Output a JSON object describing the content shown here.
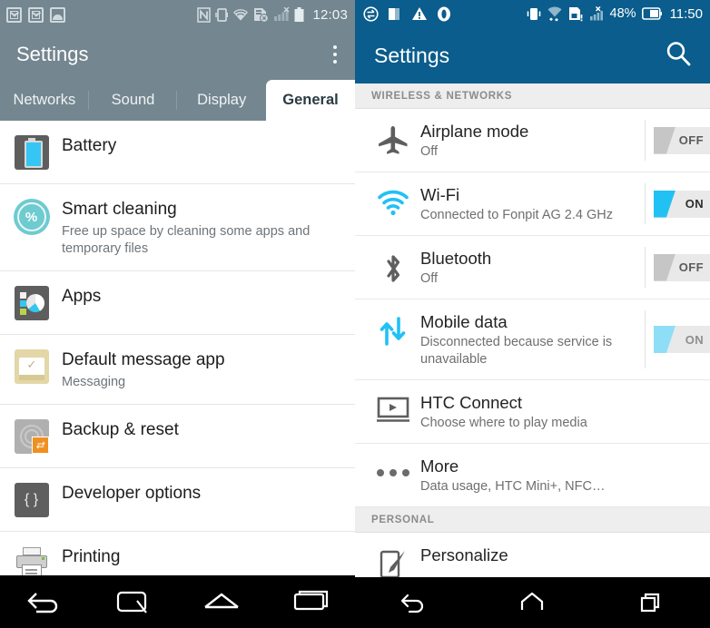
{
  "left_panel": {
    "platform": "lg-settings",
    "status_bar": {
      "left_icons": [
        "email-icon",
        "email-icon",
        "gallery-image-icon"
      ],
      "right_icons": [
        "nfc-icon",
        "vibrate-icon",
        "wifi-icon",
        "sim-error-icon",
        "signal-bars-icon",
        "battery-icon"
      ],
      "clock": "12:03"
    },
    "title": "Settings",
    "overflow_menu": "overflow-menu",
    "tabs": [
      {
        "label": "Networks",
        "active": false
      },
      {
        "label": "Sound",
        "active": false
      },
      {
        "label": "Display",
        "active": false
      },
      {
        "label": "General",
        "active": true
      }
    ],
    "items": [
      {
        "icon": "battery-icon",
        "title": "Battery",
        "subtitle": ""
      },
      {
        "icon": "smart-cleaning-icon",
        "title": "Smart cleaning",
        "subtitle": "Free up space by cleaning some apps and temporary files"
      },
      {
        "icon": "apps-icon",
        "title": "Apps",
        "subtitle": ""
      },
      {
        "icon": "default-message-app-icon",
        "title": "Default message app",
        "subtitle": "Messaging"
      },
      {
        "icon": "backup-reset-icon",
        "title": "Backup & reset",
        "subtitle": ""
      },
      {
        "icon": "developer-options-icon",
        "title": "Developer options",
        "subtitle": ""
      },
      {
        "icon": "printing-icon",
        "title": "Printing",
        "subtitle": ""
      }
    ],
    "nav": [
      "back-icon",
      "menu-icon",
      "home-icon",
      "recents-icon"
    ]
  },
  "right_panel": {
    "platform": "htc-settings",
    "status_bar": {
      "left_icons": [
        "sync-icon",
        "sd-card-icon",
        "warning-icon",
        "opera-icon"
      ],
      "right_icons": [
        "vibrate-icon",
        "wifi-transfer-icon",
        "storage-alert-icon",
        "signal-no-service-icon"
      ],
      "battery_percent": "48%",
      "clock": "11:50"
    },
    "title": "Settings",
    "search_icon": "search-icon",
    "sections": [
      {
        "header": "WIRELESS & NETWORKS",
        "items": [
          {
            "icon": "airplane-icon",
            "title": "Airplane mode",
            "subtitle": "Off",
            "toggle": "OFF",
            "toggle_state": "off"
          },
          {
            "icon": "wifi-icon",
            "title": "Wi-Fi",
            "subtitle": "Connected to Fonpit AG 2.4 GHz",
            "toggle": "ON",
            "toggle_state": "on"
          },
          {
            "icon": "bluetooth-icon",
            "title": "Bluetooth",
            "subtitle": "Off",
            "toggle": "OFF",
            "toggle_state": "off"
          },
          {
            "icon": "mobile-data-icon",
            "title": "Mobile data",
            "subtitle": "Disconnected because service is unavailable",
            "toggle": "ON",
            "toggle_state": "on-dim"
          },
          {
            "icon": "htc-connect-icon",
            "title": "HTC Connect",
            "subtitle": "Choose where to play media",
            "toggle": "",
            "toggle_state": "none"
          },
          {
            "icon": "more-icon",
            "title": "More",
            "subtitle": "Data usage, HTC Mini+, NFC…",
            "toggle": "",
            "toggle_state": "none"
          }
        ]
      },
      {
        "header": "PERSONAL",
        "items": [
          {
            "icon": "personalize-icon",
            "title": "Personalize",
            "subtitle": "",
            "toggle": "",
            "toggle_state": "none"
          }
        ]
      }
    ],
    "nav": [
      "back-icon",
      "home-icon",
      "recents-icon"
    ]
  },
  "colors": {
    "lg_header": "#74868f",
    "htc_header": "#0a5d8c",
    "accent_cyan": "#21c1f3",
    "toggle_off": "#c6c6c6",
    "section_bg": "#eeeeee"
  }
}
